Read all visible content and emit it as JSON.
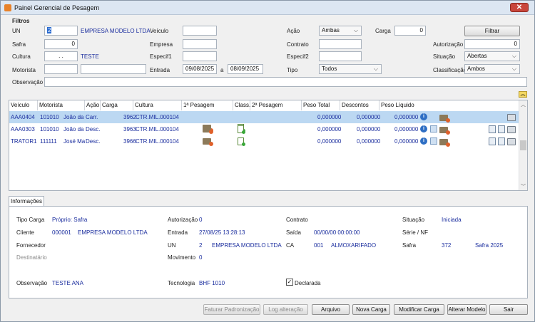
{
  "window": {
    "title": "Painel Gerencial de Pesagem",
    "close": "✕"
  },
  "filters": {
    "section_title": "Filtros",
    "un_label": "UN",
    "un_value": "2",
    "un_name": "EMPRESA MODELO LTDA",
    "veiculo_label": "Veículo",
    "veiculo_value": "",
    "acao_label": "Ação",
    "acao_value": "Ambas",
    "carga_label": "Carga",
    "carga_value": "0",
    "filter_button": "Filtrar",
    "safra_label": "Safra",
    "safra_value": "0",
    "empresa_label": "Empresa",
    "empresa_value": "",
    "contrato_label": "Contrato",
    "contrato_value": "",
    "autorizacao_label": "Autorização",
    "autorizacao_value": "0",
    "cultura_label": "Cultura",
    "cultura_value": ". .",
    "cultura_name": "TESTE",
    "especif1_label": "Especif1",
    "especif1_value": "",
    "especif2_label": "Especif2",
    "especif2_value": "",
    "situacao_label": "Situação",
    "situacao_value": "Abertas",
    "motorista_label": "Motorista",
    "motorista_value": "",
    "motorista_name": "",
    "entrada_label": "Entrada",
    "entrada_from": "09/08/2025",
    "entrada_sep": "a",
    "entrada_to": "08/09/2025",
    "tipo_label": "Tipo",
    "tipo_value": "Todos",
    "classificacao_label": "Classificação",
    "classificacao_value": "Ambos",
    "observacao_label": "Observação",
    "observacao_value": ""
  },
  "grid": {
    "columns": [
      "Veículo",
      "Motorista",
      "Ação",
      "Carga",
      "Cultura",
      "1ª Pesagem",
      "Class.",
      "2ª Pesagem",
      "Peso Total",
      "Descontos",
      "Peso Líquido"
    ],
    "rows": [
      {
        "veiculo": "AAA0404",
        "motorista_code": "101010",
        "motorista_name": "João da !",
        "acao": "Carr.",
        "carga": "3962",
        "cultura": "CTR.MIL.000104",
        "peso_total": "0,000000",
        "descontos": "0,000000",
        "peso_liquido": "0,000000",
        "selected": true
      },
      {
        "veiculo": "AAA0303",
        "motorista_code": "101010",
        "motorista_name": "João da !",
        "acao": "Desc.",
        "carga": "3963",
        "cultura": "CTR.MIL.000104",
        "peso_total": "0,000000",
        "descontos": "0,000000",
        "peso_liquido": "0,000000",
        "selected": false
      },
      {
        "veiculo": "TRATOR1",
        "motorista_code": "111111",
        "motorista_name": "José Mar",
        "acao": "Desc.",
        "carga": "3966",
        "cultura": "CTR.MIL.000104",
        "peso_total": "0,000000",
        "descontos": "0,000000",
        "peso_liquido": "0,000000",
        "selected": false
      }
    ]
  },
  "info": {
    "tab": "Informações",
    "tipo_carga_label": "Tipo Carga",
    "tipo_carga_value": "Próprio: Safra",
    "autorizacao_label": "Autorização",
    "autorizacao_value": "0",
    "contrato_label": "Contrato",
    "situacao_label": "Situação",
    "situacao_value": "Iniciada",
    "cliente_label": "Cliente",
    "cliente_code": "000001",
    "cliente_name": "EMPRESA MODELO LTDA",
    "entrada_label": "Entrada",
    "entrada_value": "27/08/25 13:28:13",
    "saida_label": "Saída",
    "saida_value": "00/00/00 00:00:00",
    "serie_label": "Série / NF",
    "fornecedor_label": "Fornecedor",
    "un_label": "UN",
    "un_code": "2",
    "un_name": "EMPRESA MODELO LTDA",
    "ca_label": "CA",
    "ca_code": "001",
    "ca_name": "ALMOXARIFADO",
    "safra_label": "Safra",
    "safra_code": "372",
    "safra_name": "Safra 2025",
    "destinatario_label": "Destinatário",
    "movimento_label": "Movimento",
    "movimento_value": "0",
    "observacao_label": "Observação",
    "observacao_value": "TESTE ANA",
    "tecnologia_label": "Tecnologia",
    "tecnologia_value": "BHF 1010",
    "declarada_label": "Declarada",
    "declarada_checked": true
  },
  "buttons": {
    "faturar": "Faturar Padronização",
    "log": "Log alteração",
    "arquivo": "Arquivo",
    "nova_carga": "Nova Carga",
    "modificar_carga": "Modificar Carga",
    "alterar_modelo": "Alterar Modelo",
    "sair": "Sair"
  }
}
